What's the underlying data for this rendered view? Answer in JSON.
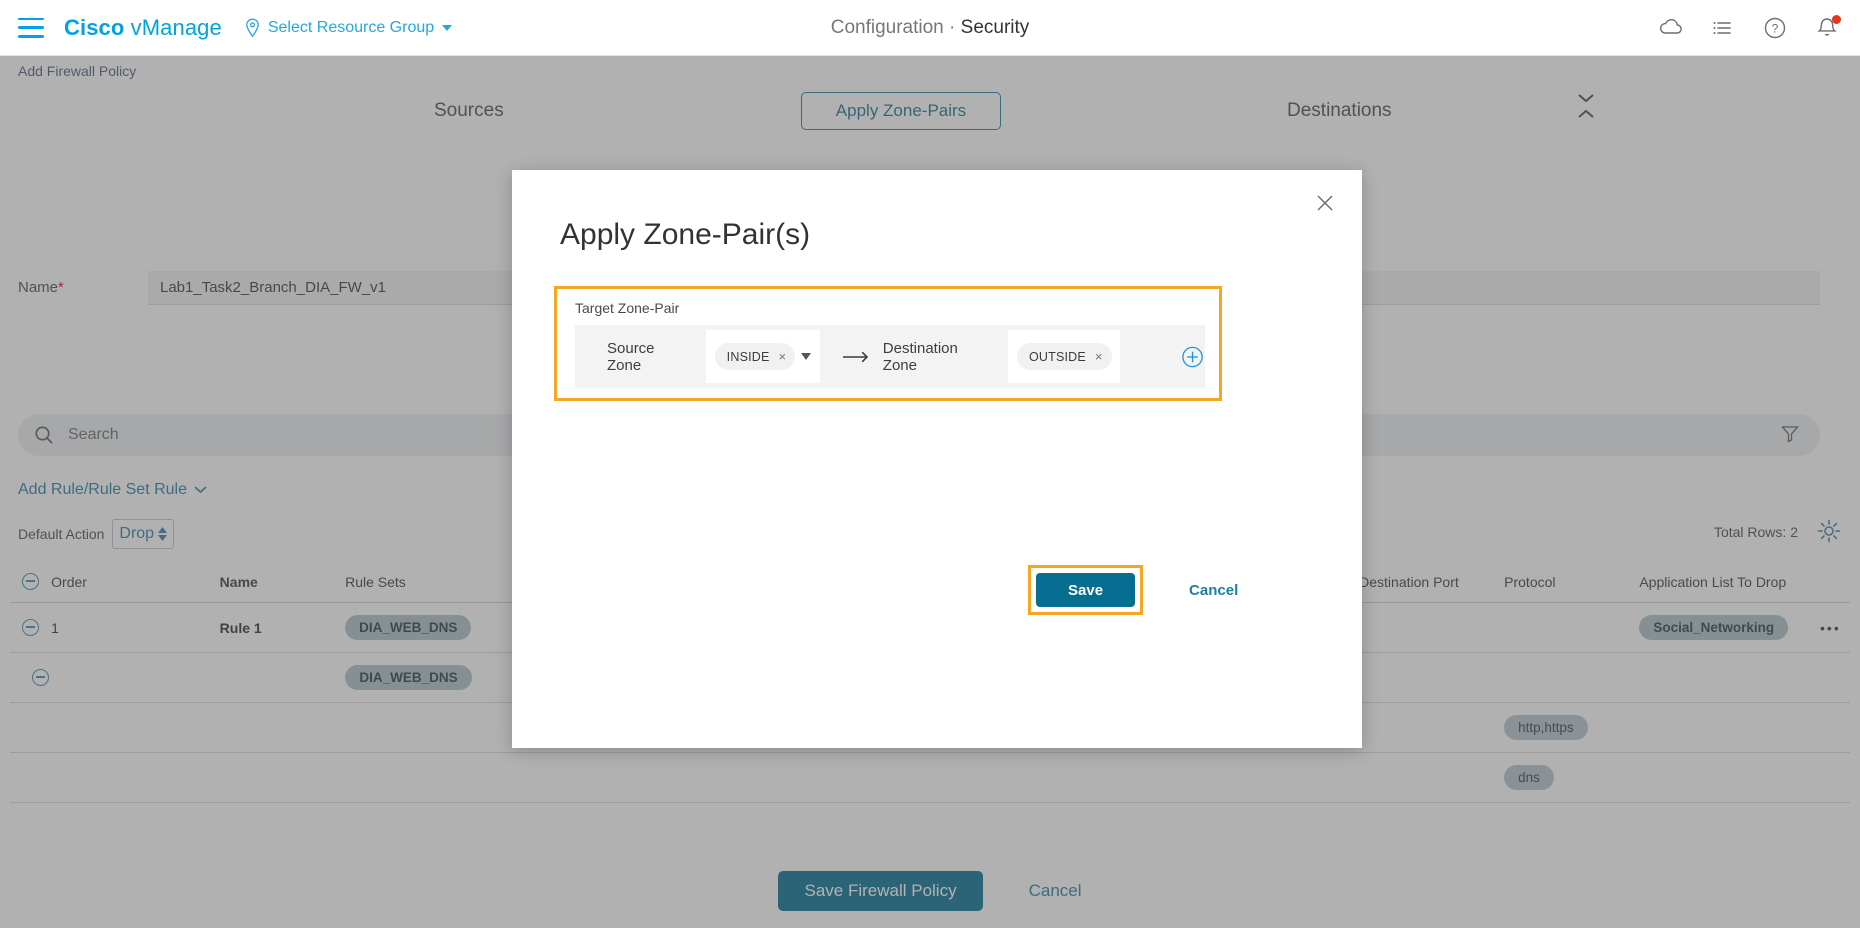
{
  "header": {
    "brand_primary": "Cisco",
    "brand_secondary": "vManage",
    "resource_group": "Select Resource Group",
    "title_section": "Configuration",
    "title_sep": "·",
    "title_page": "Security",
    "icons": [
      "cloud-icon",
      "list-icon",
      "help-icon",
      "notification-bell-icon"
    ]
  },
  "breadcrumb": "Add Firewall Policy",
  "zone_strip": {
    "sources_label": "Sources",
    "apply_button": "Apply Zone-Pairs",
    "destinations_label": "Destinations"
  },
  "form": {
    "name_label": "Name",
    "name_required_mark": "*",
    "name_value": "Lab1_Task2_Branch_DIA_FW_v1"
  },
  "search": {
    "placeholder": "Search"
  },
  "toolbar": {
    "add_rule_label": "Add Rule/Rule Set Rule",
    "default_action_label": "Default Action",
    "default_action_value": "Drop",
    "total_rows": "Total Rows: 2"
  },
  "table": {
    "columns": [
      "Order",
      "Name",
      "Rule Sets",
      "Destination Port",
      "Protocol",
      "Application List To Drop"
    ],
    "rows": [
      {
        "order": "1",
        "name": "Rule 1",
        "rule_set": "DIA_WEB_DNS",
        "destination_port": "",
        "protocol": "",
        "application_list": "Social_Networking",
        "menu": "•••"
      },
      {
        "order": "",
        "name": "",
        "rule_set": "DIA_WEB_DNS",
        "destination_port": "",
        "protocol": "",
        "application_list": "",
        "menu": ""
      },
      {
        "order": "",
        "name": "",
        "rule_set": "",
        "destination_port": "",
        "protocol": "http,https",
        "application_list": "",
        "menu": ""
      },
      {
        "order": "",
        "name": "",
        "rule_set": "",
        "destination_port": "",
        "protocol": "dns",
        "application_list": "",
        "menu": ""
      }
    ]
  },
  "footer": {
    "save_policy_label": "Save Firewall Policy",
    "cancel_label": "Cancel"
  },
  "modal": {
    "title": "Apply Zone-Pair(s)",
    "target_zone_pair_label": "Target Zone-Pair",
    "source_zone_label": "Source Zone",
    "source_zone_value": "INSIDE",
    "destination_zone_label": "Destination Zone",
    "destination_zone_value": "OUTSIDE",
    "chip_remove_glyph": "×",
    "add_pair_icon": "plus-circle-icon",
    "save_label": "Save",
    "cancel_label": "Cancel"
  },
  "colors": {
    "brand_blue": "#00a3e0",
    "link_blue": "#1f7fa3",
    "primary_button": "#056e91",
    "highlight_orange": "#f5a623",
    "pill_grey_blue": "#adc0cb",
    "alert_red": "#e8341b"
  }
}
